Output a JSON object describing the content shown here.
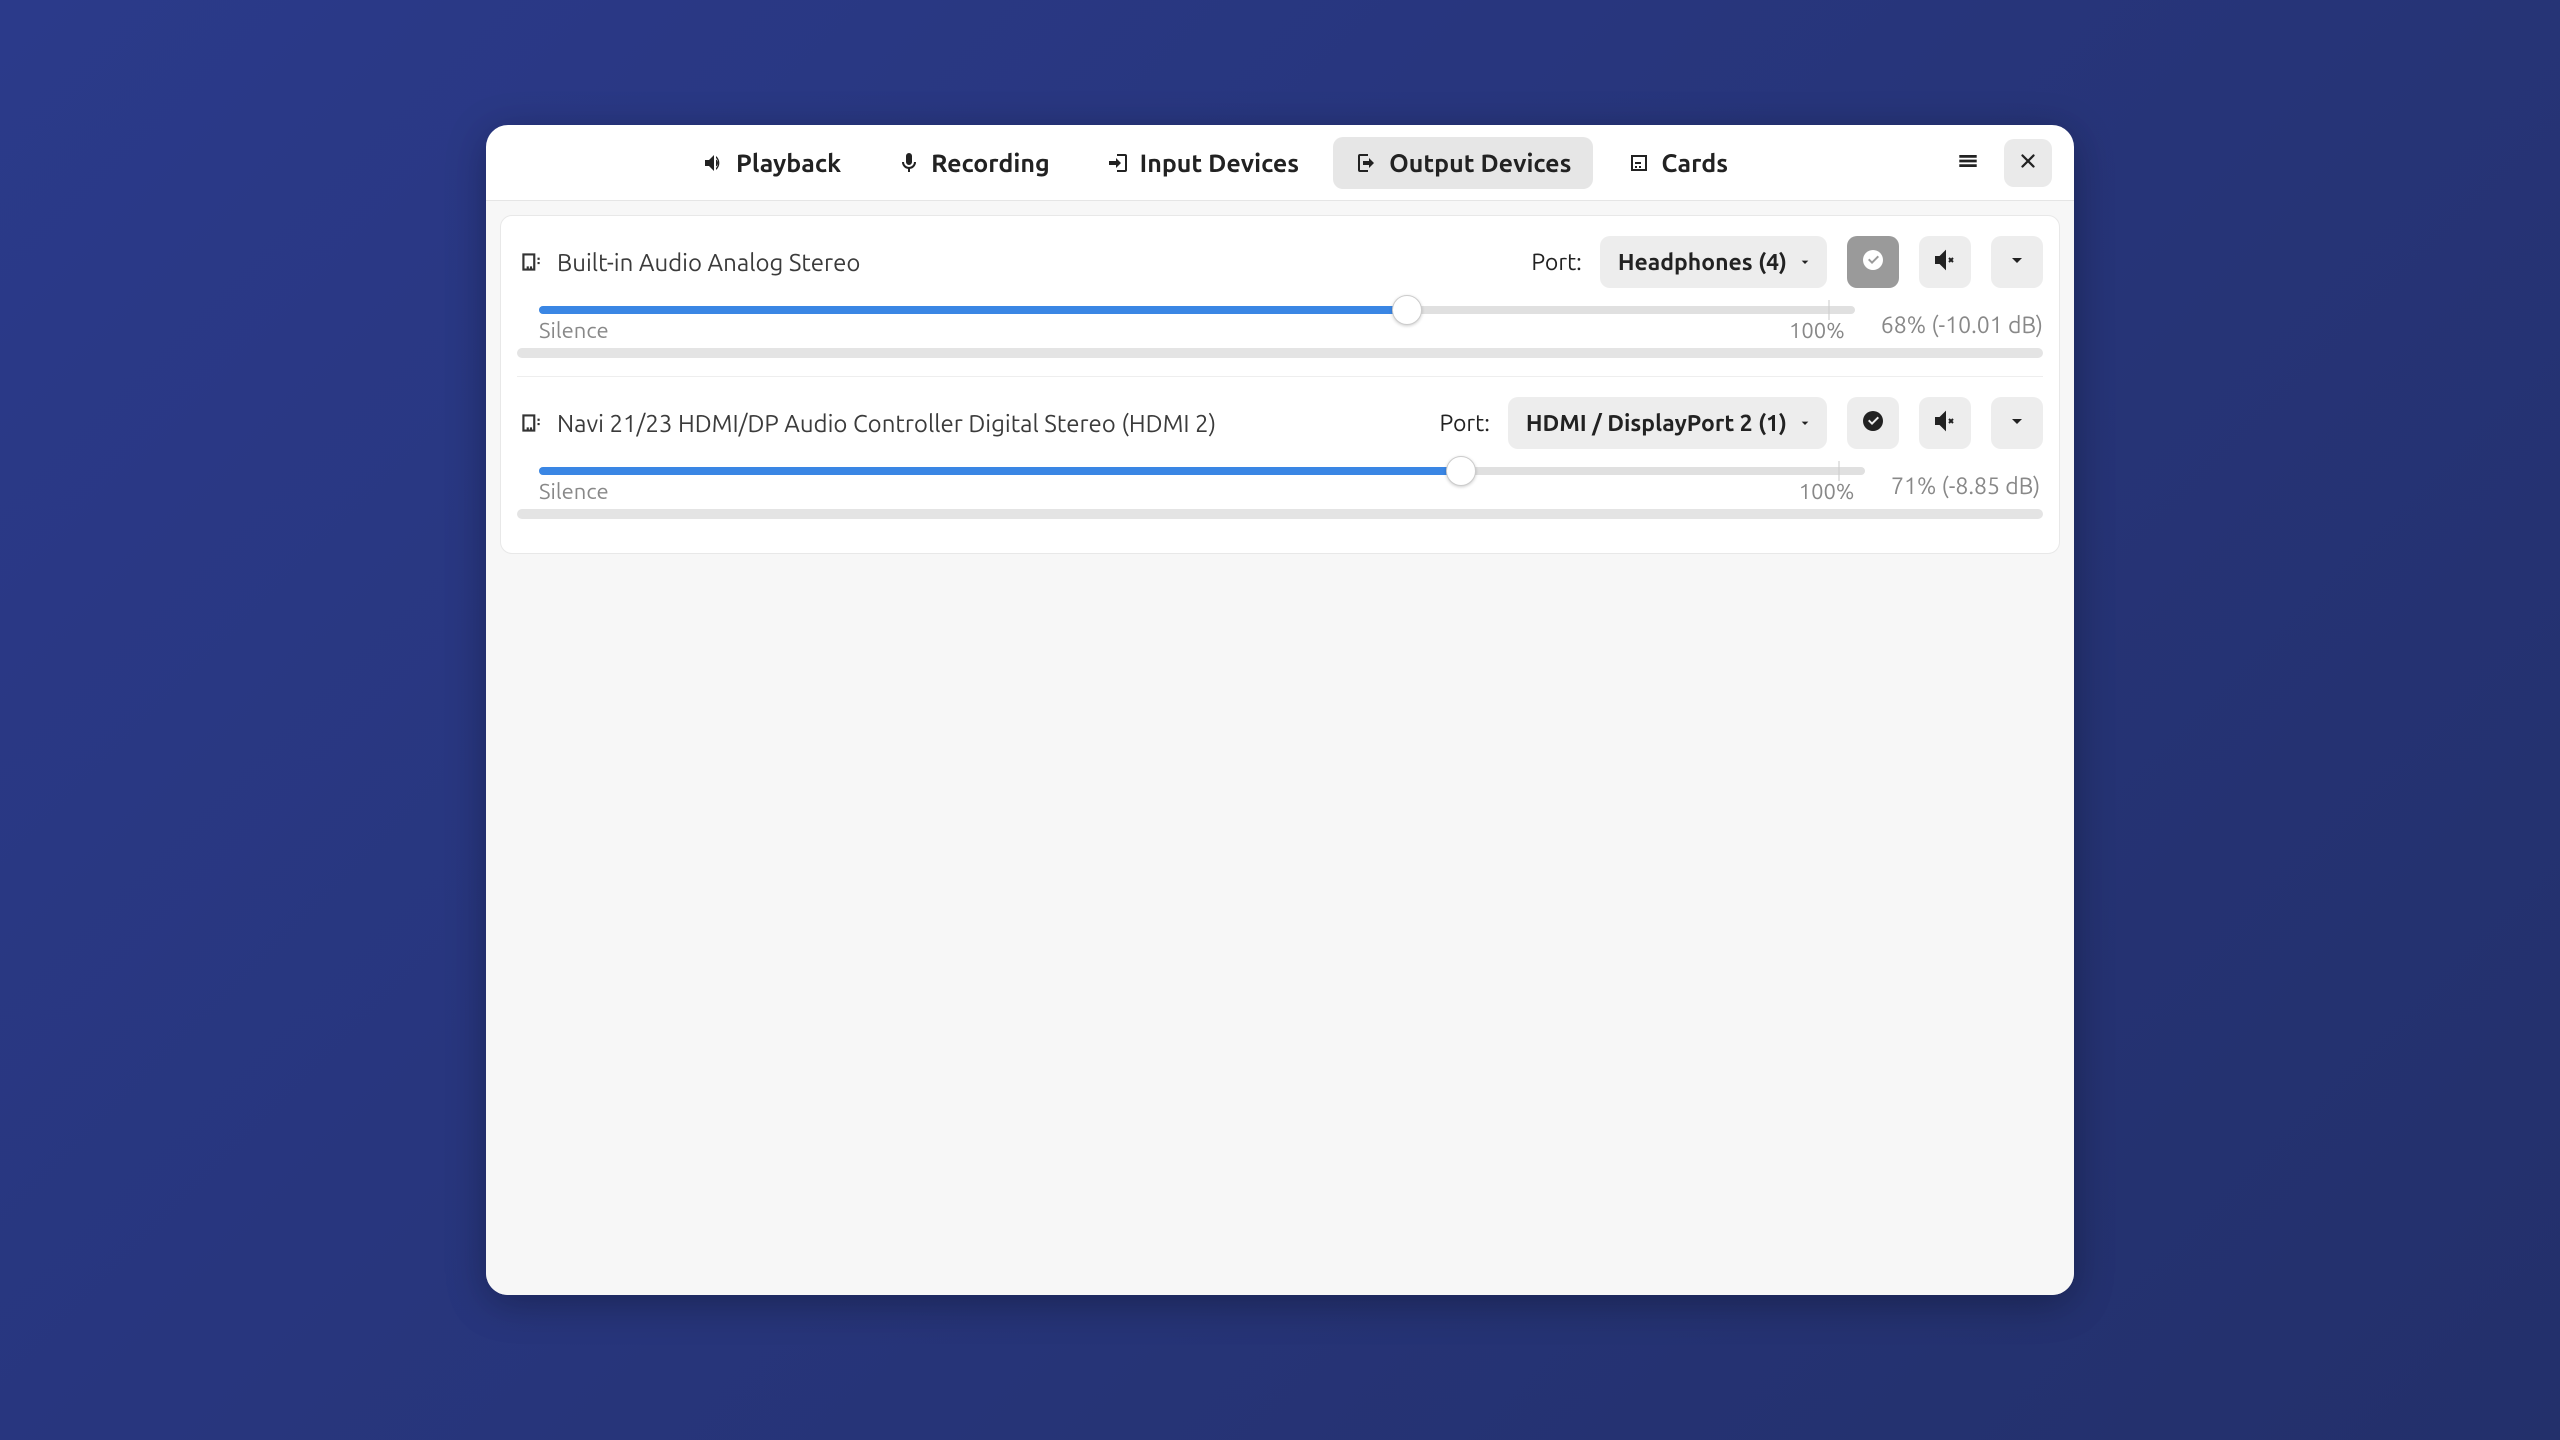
{
  "tabs": {
    "playback": "Playback",
    "recording": "Recording",
    "input_devices": "Input Devices",
    "output_devices": "Output Devices",
    "cards": "Cards"
  },
  "port_label": "Port:",
  "slider_labels": {
    "silence": "Silence",
    "hundred": "100%"
  },
  "devices": [
    {
      "name": "Built-in Audio Analog Stereo",
      "port_selected": "Headphones (4)",
      "default_active": true,
      "volume_text": "68% (-10.01 dB)",
      "volume_percent": 68
    },
    {
      "name": "Navi 21/23 HDMI/DP Audio Controller Digital Stereo (HDMI 2)",
      "port_selected": "HDMI / DisplayPort 2 (1)",
      "default_active": false,
      "volume_text": "71% (-8.85 dB)",
      "volume_percent": 71
    }
  ]
}
